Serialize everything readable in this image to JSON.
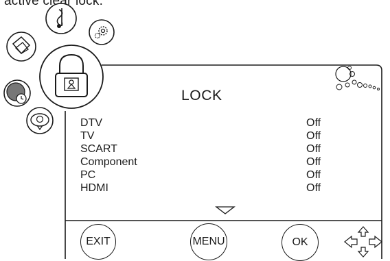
{
  "header": {
    "caption": "r active clear lock."
  },
  "menu": {
    "title": "LOCK",
    "rows": [
      {
        "label": "DTV",
        "value": "Off"
      },
      {
        "label": "TV",
        "value": "Off"
      },
      {
        "label": "SCART",
        "value": "Off"
      },
      {
        "label": "Component",
        "value": "Off"
      },
      {
        "label": "PC",
        "value": "Off"
      },
      {
        "label": "HDMI",
        "value": "Off"
      }
    ]
  },
  "footer": {
    "exit_label": "EXIT",
    "menu_label": "MENU",
    "ok_label": "OK"
  },
  "icons": [
    "music-icon",
    "settings-icon",
    "picture-icon",
    "lock-icon",
    "clock-icon",
    "channel-icon",
    "bubbles-decoration-icon",
    "scroll-down-arrow-icon",
    "navigation-arrows-icon"
  ]
}
